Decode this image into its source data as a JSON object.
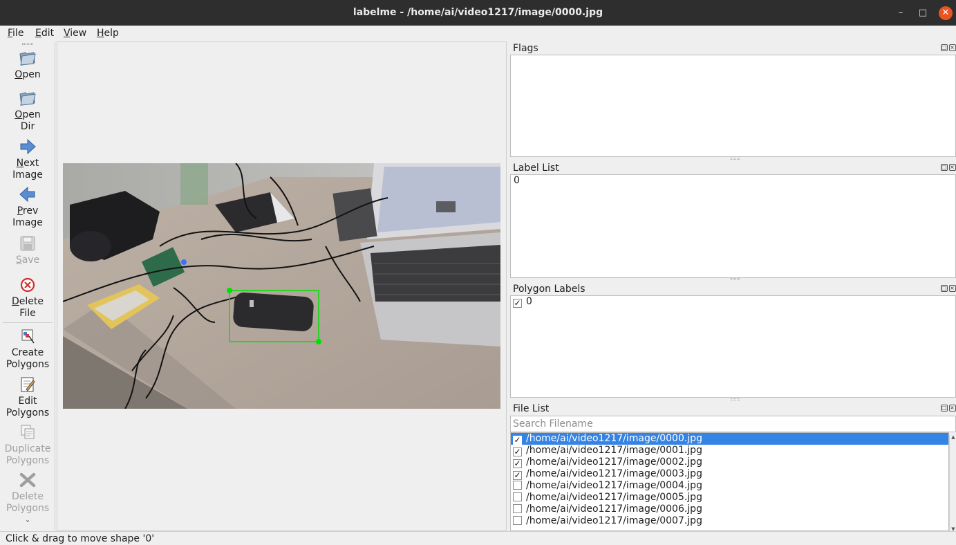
{
  "window": {
    "title": "labelme - /home/ai/video1217/image/0000.jpg",
    "minimize_glyph": "–",
    "maximize_glyph": "□",
    "close_glyph": "✕"
  },
  "menu": {
    "file": {
      "ul": "F",
      "rest": "ile"
    },
    "edit": {
      "ul": "E",
      "rest": "dit"
    },
    "view": {
      "ul": "V",
      "rest": "iew"
    },
    "help": {
      "ul": "H",
      "rest": "elp"
    }
  },
  "toolbar": {
    "open": {
      "ul": "O",
      "rest": "pen",
      "icon": "folder-open-icon",
      "enabled": true
    },
    "open_dir": {
      "ul": "O",
      "rest": "pen",
      "line2": "Dir",
      "icon": "folder-open-icon",
      "enabled": true
    },
    "next_image": {
      "ul": "N",
      "rest": "ext",
      "line2": "Image",
      "icon": "arrow-right-icon",
      "enabled": true
    },
    "prev_image": {
      "ul": "P",
      "rest": "rev",
      "line2": "Image",
      "icon": "arrow-left-icon",
      "enabled": true
    },
    "save": {
      "ul": "S",
      "rest": "ave",
      "icon": "floppy-disk-icon",
      "enabled": false
    },
    "delete_file": {
      "ul": "D",
      "rest": "elete",
      "line2": "File",
      "icon": "delete-circle-icon",
      "enabled": true
    },
    "create_polygons": {
      "line1": "Create",
      "line2": "Polygons",
      "icon": "create-polygon-icon",
      "enabled": true
    },
    "edit_polygons": {
      "line1": "Edit",
      "line2": "Polygons",
      "icon": "edit-polygon-icon",
      "enabled": true
    },
    "duplicate_polygons": {
      "line1": "Duplicate",
      "line2": "Polygons",
      "icon": "duplicate-icon",
      "enabled": false
    },
    "delete_polygons": {
      "line1": "Delete",
      "line2": "Polygons",
      "icon": "cancel-x-icon",
      "enabled": false
    },
    "more_glyph": "ˇ"
  },
  "docks": {
    "flags": {
      "title": "Flags",
      "items": []
    },
    "label_list": {
      "title": "Label List",
      "items": [
        "0"
      ]
    },
    "polygon_labels": {
      "title": "Polygon Labels",
      "items": [
        {
          "label": "0",
          "checked": true
        }
      ]
    },
    "file_list": {
      "title": "File List",
      "search_placeholder": "Search Filename",
      "files": [
        {
          "name": "/home/ai/video1217/image/0000.jpg",
          "checked": true,
          "selected": true
        },
        {
          "name": "/home/ai/video1217/image/0001.jpg",
          "checked": true,
          "selected": false
        },
        {
          "name": "/home/ai/video1217/image/0002.jpg",
          "checked": true,
          "selected": false
        },
        {
          "name": "/home/ai/video1217/image/0003.jpg",
          "checked": true,
          "selected": false
        },
        {
          "name": "/home/ai/video1217/image/0004.jpg",
          "checked": false,
          "selected": false
        },
        {
          "name": "/home/ai/video1217/image/0005.jpg",
          "checked": false,
          "selected": false
        },
        {
          "name": "/home/ai/video1217/image/0006.jpg",
          "checked": false,
          "selected": false
        },
        {
          "name": "/home/ai/video1217/image/0007.jpg",
          "checked": false,
          "selected": false
        }
      ]
    }
  },
  "annotation": {
    "shape_label": "0",
    "shape_type": "rectangle",
    "color": "#00e000"
  },
  "status": {
    "message": "Click & drag to move shape '0'"
  },
  "colors": {
    "selection": "#3584e4",
    "close_button": "#e95420",
    "titlebar": "#2e2e2e"
  }
}
